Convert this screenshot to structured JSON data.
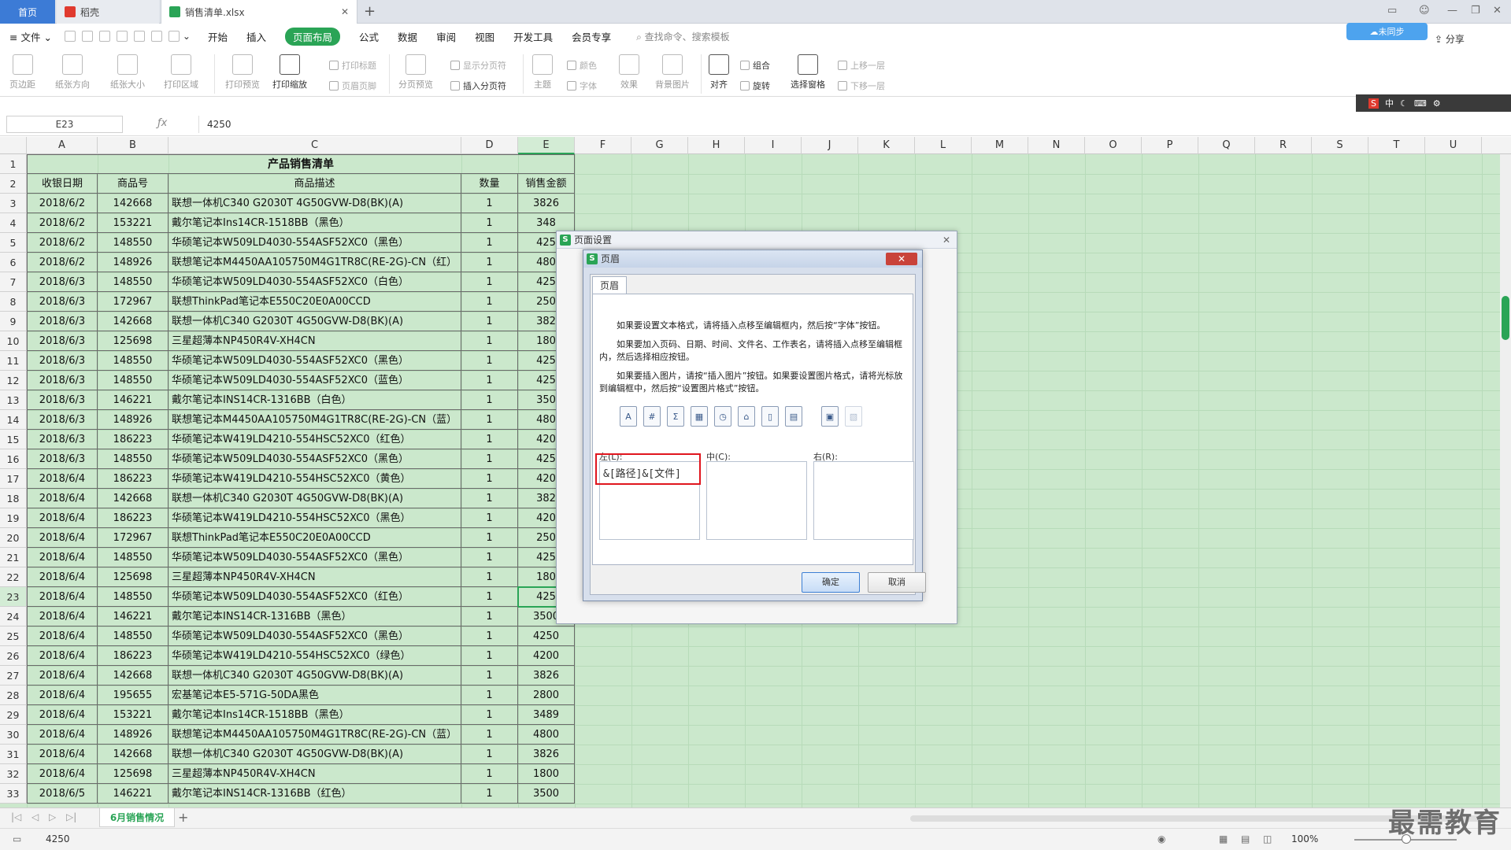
{
  "tabs": {
    "home": "首页",
    "wps": "稻壳",
    "file": "销售清单.xlsx"
  },
  "menu": {
    "file": "文件",
    "items": [
      "开始",
      "插入",
      "页面布局",
      "公式",
      "数据",
      "审阅",
      "视图",
      "开发工具",
      "会员专享"
    ],
    "active": "页面布局",
    "search": "查找命令、搜索模板",
    "cloud": "未同步",
    "share": "分享"
  },
  "ribbon": {
    "big": [
      {
        "label": "页边距"
      },
      {
        "label": "纸张方向"
      },
      {
        "label": "纸张大小"
      },
      {
        "label": "打印区域"
      },
      {
        "label": "打印预览"
      },
      {
        "label": "打印缩放"
      },
      {
        "label": "分页预览"
      },
      {
        "label": "主题"
      },
      {
        "label": "效果"
      },
      {
        "label": "背景图片"
      },
      {
        "label": "对齐"
      },
      {
        "label": "选择窗格"
      }
    ],
    "small": [
      "打印标题",
      "页眉页脚",
      "显示分页符",
      "插入分页符",
      "颜色",
      "字体",
      "组合",
      "旋转",
      "上移一层",
      "下移一层"
    ]
  },
  "ime": "中",
  "formula": {
    "name": "E23",
    "value": "4250"
  },
  "columns": [
    "A",
    "B",
    "C",
    "D",
    "E",
    "F",
    "G",
    "H",
    "I",
    "J",
    "K",
    "L",
    "M",
    "N",
    "O",
    "P",
    "Q",
    "R",
    "S",
    "T",
    "U"
  ],
  "selected_cell": {
    "row": "23",
    "col": "E"
  },
  "sheet": {
    "title": "产品销售清单",
    "headers": [
      "收银日期",
      "商品号",
      "商品描述",
      "数量",
      "销售金额"
    ],
    "rows": [
      {
        "r": "3",
        "a": "2018/6/2",
        "b": "142668",
        "c": "联想一体机C340 G2030T 4G50GVW-D8(BK)(A)",
        "d": "1",
        "e": "3826"
      },
      {
        "r": "4",
        "a": "2018/6/2",
        "b": "153221",
        "c": "戴尔笔记本Ins14CR-1518BB（黑色）",
        "d": "1",
        "e": "348"
      },
      {
        "r": "5",
        "a": "2018/6/2",
        "b": "148550",
        "c": "华硕笔记本W509LD4030-554ASF52XC0（黑色）",
        "d": "1",
        "e": "425"
      },
      {
        "r": "6",
        "a": "2018/6/2",
        "b": "148926",
        "c": "联想笔记本M4450AA105750M4G1TR8C(RE-2G)-CN（红）",
        "d": "1",
        "e": "480"
      },
      {
        "r": "7",
        "a": "2018/6/3",
        "b": "148550",
        "c": "华硕笔记本W509LD4030-554ASF52XC0（白色）",
        "d": "1",
        "e": "425"
      },
      {
        "r": "8",
        "a": "2018/6/3",
        "b": "172967",
        "c": "联想ThinkPad笔记本E550C20E0A00CCD",
        "d": "1",
        "e": "250"
      },
      {
        "r": "9",
        "a": "2018/6/3",
        "b": "142668",
        "c": "联想一体机C340 G2030T 4G50GVW-D8(BK)(A)",
        "d": "1",
        "e": "382"
      },
      {
        "r": "10",
        "a": "2018/6/3",
        "b": "125698",
        "c": "三星超薄本NP450R4V-XH4CN",
        "d": "1",
        "e": "180"
      },
      {
        "r": "11",
        "a": "2018/6/3",
        "b": "148550",
        "c": "华硕笔记本W509LD4030-554ASF52XC0（黑色）",
        "d": "1",
        "e": "425"
      },
      {
        "r": "12",
        "a": "2018/6/3",
        "b": "148550",
        "c": "华硕笔记本W509LD4030-554ASF52XC0（蓝色）",
        "d": "1",
        "e": "425"
      },
      {
        "r": "13",
        "a": "2018/6/3",
        "b": "146221",
        "c": "戴尔笔记本INS14CR-1316BB（白色）",
        "d": "1",
        "e": "350"
      },
      {
        "r": "14",
        "a": "2018/6/3",
        "b": "148926",
        "c": "联想笔记本M4450AA105750M4G1TR8C(RE-2G)-CN（蓝）",
        "d": "1",
        "e": "480"
      },
      {
        "r": "15",
        "a": "2018/6/3",
        "b": "186223",
        "c": "华硕笔记本W419LD4210-554HSC52XC0（红色）",
        "d": "1",
        "e": "420"
      },
      {
        "r": "16",
        "a": "2018/6/3",
        "b": "148550",
        "c": "华硕笔记本W509LD4030-554ASF52XC0（黑色）",
        "d": "1",
        "e": "425"
      },
      {
        "r": "17",
        "a": "2018/6/4",
        "b": "186223",
        "c": "华硕笔记本W419LD4210-554HSC52XC0（黄色）",
        "d": "1",
        "e": "420"
      },
      {
        "r": "18",
        "a": "2018/6/4",
        "b": "142668",
        "c": "联想一体机C340 G2030T 4G50GVW-D8(BK)(A)",
        "d": "1",
        "e": "382"
      },
      {
        "r": "19",
        "a": "2018/6/4",
        "b": "186223",
        "c": "华硕笔记本W419LD4210-554HSC52XC0（黑色）",
        "d": "1",
        "e": "420"
      },
      {
        "r": "20",
        "a": "2018/6/4",
        "b": "172967",
        "c": "联想ThinkPad笔记本E550C20E0A00CCD",
        "d": "1",
        "e": "250"
      },
      {
        "r": "21",
        "a": "2018/6/4",
        "b": "148550",
        "c": "华硕笔记本W509LD4030-554ASF52XC0（黑色）",
        "d": "1",
        "e": "425"
      },
      {
        "r": "22",
        "a": "2018/6/4",
        "b": "125698",
        "c": "三星超薄本NP450R4V-XH4CN",
        "d": "1",
        "e": "180"
      },
      {
        "r": "23",
        "a": "2018/6/4",
        "b": "148550",
        "c": "华硕笔记本W509LD4030-554ASF52XC0（红色）",
        "d": "1",
        "e": "425"
      },
      {
        "r": "24",
        "a": "2018/6/4",
        "b": "146221",
        "c": "戴尔笔记本INS14CR-1316BB（黑色）",
        "d": "1",
        "e": "3500"
      },
      {
        "r": "25",
        "a": "2018/6/4",
        "b": "148550",
        "c": "华硕笔记本W509LD4030-554ASF52XC0（黑色）",
        "d": "1",
        "e": "4250"
      },
      {
        "r": "26",
        "a": "2018/6/4",
        "b": "186223",
        "c": "华硕笔记本W419LD4210-554HSC52XC0（绿色）",
        "d": "1",
        "e": "4200"
      },
      {
        "r": "27",
        "a": "2018/6/4",
        "b": "142668",
        "c": "联想一体机C340 G2030T 4G50GVW-D8(BK)(A)",
        "d": "1",
        "e": "3826"
      },
      {
        "r": "28",
        "a": "2018/6/4",
        "b": "195655",
        "c": "宏基笔记本E5-571G-50DA黑色",
        "d": "1",
        "e": "2800"
      },
      {
        "r": "29",
        "a": "2018/6/4",
        "b": "153221",
        "c": "戴尔笔记本Ins14CR-1518BB（黑色）",
        "d": "1",
        "e": "3489"
      },
      {
        "r": "30",
        "a": "2018/6/4",
        "b": "148926",
        "c": "联想笔记本M4450AA105750M4G1TR8C(RE-2G)-CN（蓝）",
        "d": "1",
        "e": "4800"
      },
      {
        "r": "31",
        "a": "2018/6/4",
        "b": "142668",
        "c": "联想一体机C340 G2030T 4G50GVW-D8(BK)(A)",
        "d": "1",
        "e": "3826"
      },
      {
        "r": "32",
        "a": "2018/6/4",
        "b": "125698",
        "c": "三星超薄本NP450R4V-XH4CN",
        "d": "1",
        "e": "1800"
      },
      {
        "r": "33",
        "a": "2018/6/5",
        "b": "146221",
        "c": "戴尔笔记本INS14CR-1316BB（红色）",
        "d": "1",
        "e": "3500"
      }
    ]
  },
  "sheet_tab": "6月销售情况",
  "status": {
    "value": "4250",
    "zoom": "100%"
  },
  "dialog_page_setup": {
    "title": "页面设置"
  },
  "dialog_header": {
    "title": "页眉",
    "tab": "页眉",
    "para1": "如果要设置文本格式，请将插入点移至编辑框内，然后按“字体”按钮。",
    "para2": "如果要加入页码、日期、时间、文件名、工作表名，请将插入点移至编辑框内，然后选择相应按钮。",
    "para3": "如果要插入图片，请按“插入图片”按钮。如果要设置图片格式，请将光标放到编辑框中，然后按“设置图片格式”按钮。",
    "left_label": "左(L):",
    "center_label": "中(C):",
    "right_label": "右(R):",
    "left_value": "&[路径]&[文件]",
    "ok": "确定",
    "cancel": "取消"
  },
  "watermark": "最需教育"
}
